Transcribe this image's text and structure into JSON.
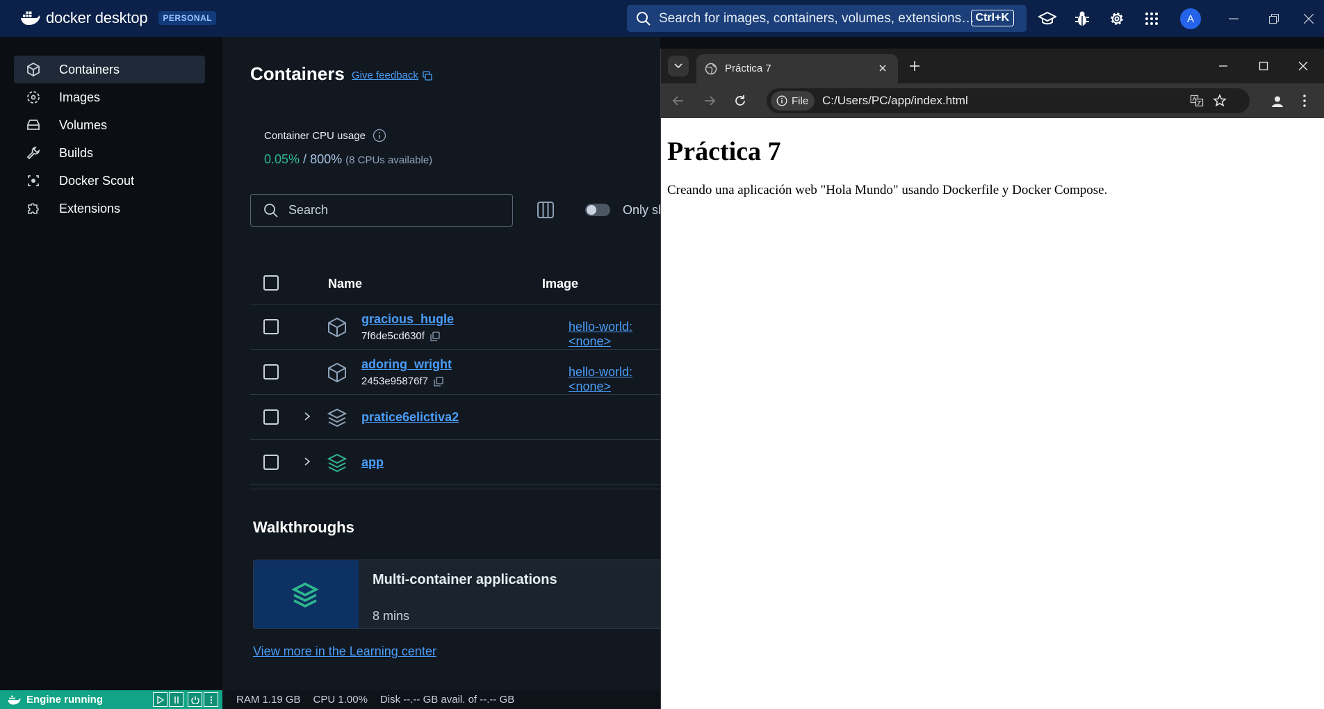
{
  "app": {
    "brand": "docker desktop",
    "plan_badge": "PERSONAL"
  },
  "global_search": {
    "placeholder": "Search for images, containers, volumes, extensions…",
    "shortcut": "Ctrl+K"
  },
  "user": {
    "avatar_initial": "A"
  },
  "sidebar": {
    "items": [
      {
        "label": "Containers",
        "icon": "container-icon",
        "active": true
      },
      {
        "label": "Images",
        "icon": "images-icon"
      },
      {
        "label": "Volumes",
        "icon": "volumes-icon"
      },
      {
        "label": "Builds",
        "icon": "builds-icon"
      },
      {
        "label": "Docker Scout",
        "icon": "scout-icon"
      },
      {
        "label": "Extensions",
        "icon": "extensions-icon"
      }
    ]
  },
  "containers": {
    "title": "Containers",
    "feedback_link": "Give feedback",
    "cpu_label": "Container CPU usage",
    "cpu_used": "0.05%",
    "cpu_sep": " / ",
    "cpu_total": "800%",
    "cpu_available": "(8 CPUs available)",
    "search_placeholder": "Search",
    "toggle_label": "Only show running containers",
    "columns": {
      "name": "Name",
      "image": "Image"
    },
    "rows": [
      {
        "name": "gracious_hugle",
        "id": "7f6de5cd630f",
        "image": "hello-world:<none>"
      },
      {
        "name": "adoring_wright",
        "id": "2453e95876f7",
        "image": "hello-world:<none>"
      },
      {
        "name": "pratice6elictiva2"
      },
      {
        "name": "app"
      }
    ]
  },
  "walkthroughs": {
    "title": "Walkthroughs",
    "card_title": "Multi-container applications",
    "card_time": "8 mins",
    "learn_link": "View more in the Learning center"
  },
  "status": {
    "engine": "Engine running",
    "ram": "RAM 1.19 GB",
    "cpu": "CPU 1.00%",
    "disk": "Disk --.-- GB avail. of --.-- GB"
  },
  "browser": {
    "tab_title": "Práctica 7",
    "scheme_chip": "File",
    "url": "C:/Users/PC/app/index.html",
    "page_heading": "Práctica 7",
    "page_text": "Creando una aplicación web \"Hola Mundo\" usando Dockerfile y Docker Compose."
  },
  "colors": {
    "topbar": "#0b214a",
    "accent_link": "#4a9df8",
    "cpu_green": "#2fb68e",
    "engine_green": "#12a486"
  }
}
